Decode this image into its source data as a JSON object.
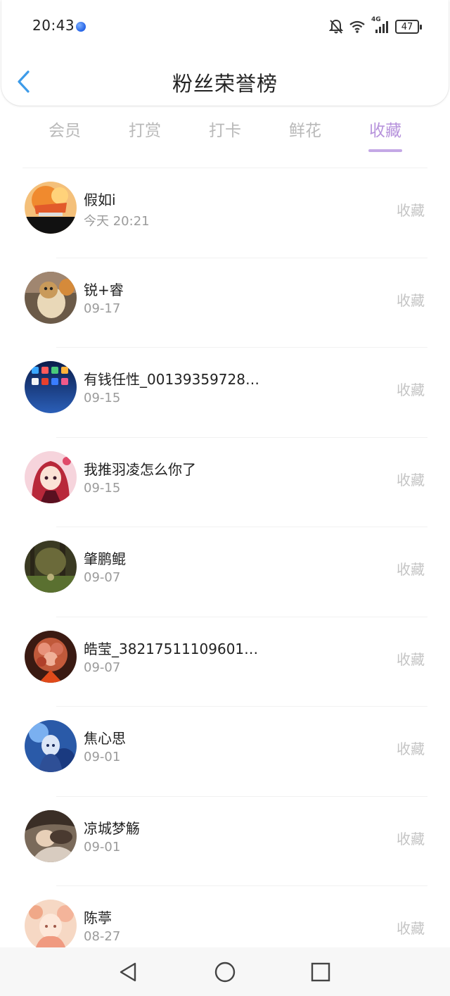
{
  "status_bar": {
    "time": "20:43",
    "network": "4G",
    "battery": "47",
    "icons": [
      "mute-bell-icon",
      "wifi-icon",
      "signal-icon",
      "battery-icon"
    ]
  },
  "header": {
    "title": "粉丝荣誉榜",
    "back_icon": "chevron-left-icon",
    "accent": "#3d9be9"
  },
  "tabs": [
    {
      "label": "会员",
      "active": false
    },
    {
      "label": "打赏",
      "active": false
    },
    {
      "label": "打卡",
      "active": false
    },
    {
      "label": "鲜花",
      "active": false
    },
    {
      "label": "收藏",
      "active": true
    }
  ],
  "tab_active_color": "#b793dc",
  "fans": [
    {
      "name": "假如i",
      "time": "今天 20:21",
      "action": "收藏",
      "avatar": "anime-orange-avatar"
    },
    {
      "name": "锐+睿",
      "time": "09-17",
      "action": "收藏",
      "avatar": "plush-toy-avatar"
    },
    {
      "name": "有钱任性_00139359728…",
      "time": "09-15",
      "action": "收藏",
      "avatar": "phone-screen-avatar"
    },
    {
      "name": "我推羽凌怎么你了",
      "time": "09-15",
      "action": "收藏",
      "avatar": "anime-red-hair-avatar"
    },
    {
      "name": "肇鹏鲲",
      "time": "09-07",
      "action": "收藏",
      "avatar": "forest-avatar"
    },
    {
      "name": "皓莹_38217511109601…",
      "time": "09-07",
      "action": "收藏",
      "avatar": "flower-bouquet-avatar"
    },
    {
      "name": "焦心思",
      "time": "09-01",
      "action": "收藏",
      "avatar": "anime-blue-avatar"
    },
    {
      "name": "凉城梦觞",
      "time": "09-01",
      "action": "收藏",
      "avatar": "sleeping-girl-avatar"
    },
    {
      "name": "陈葶",
      "time": "08-27",
      "action": "收藏",
      "avatar": "anime-pink-avatar"
    }
  ],
  "nav": [
    "back-triangle-icon",
    "home-circle-icon",
    "recents-square-icon"
  ]
}
